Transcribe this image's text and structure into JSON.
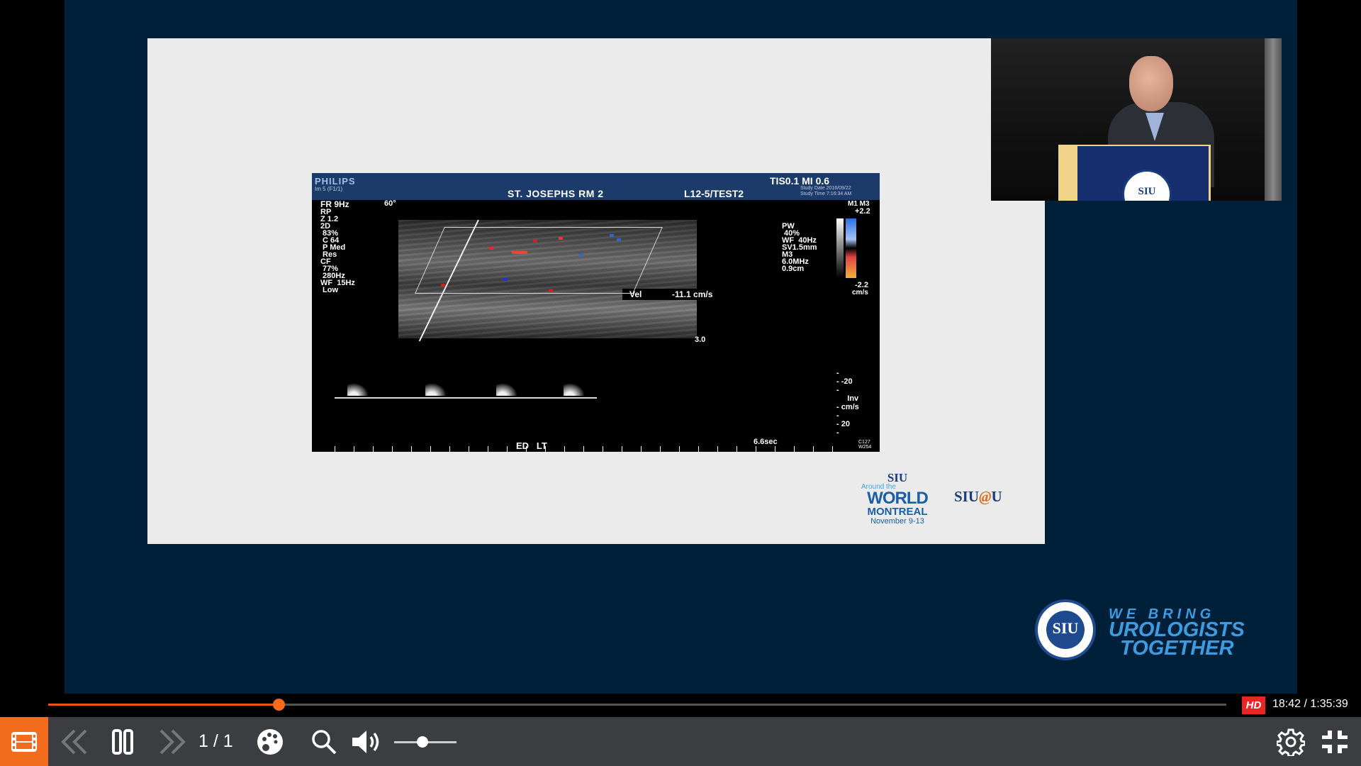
{
  "player": {
    "progress_fraction": 0.1956,
    "hd_label": "HD",
    "time": "18:42 / 1:35:39",
    "pager": "1 / 1",
    "volume_fraction": 0.45,
    "accent_color": "#f26c1d"
  },
  "icons": [
    "film-icon",
    "skip-back-icon",
    "pause-icon",
    "skip-forward-icon",
    "palette-icon",
    "search-icon",
    "volume-icon",
    "gear-icon",
    "exit-fullscreen-icon"
  ],
  "ultrasound": {
    "brand": "PHILIPS",
    "sub": "Im 5 (F1/1)",
    "site": "ST. JOSEPHS RM 2",
    "probe": "L12-5/TEST2",
    "tis": "TIS0.1   MI 0.6",
    "study": "Study Date 2016/09/22\nStudy Time 7:16:34 AM",
    "fr": "FR 9Hz",
    "angle": "60°",
    "params": "RP\nZ 1.2\n2D\n 83%\n C 64\n P Med\n Res\nCF\n 77%\n 280Hz\nWF  15Hz\n Low",
    "vel_label": "Vel",
    "vel_value": "-11.1 cm/s",
    "depth": "3.0",
    "pw": "PW\n 40%\nWF  40Hz\nSV1.5mm\nM3\n6.0MHz\n0.9cm",
    "cbar_top": "M1 M3",
    "cbar_plus": "+2.2",
    "cbar_minus": "-2.2",
    "cbar_unit": "cm/s",
    "scale": "-\n- -20\n-\n     Inv\n- cm/s\n-\n- 20\n-",
    "speed": "6.6sec",
    "bottom": "ED   LT",
    "code": "C127\nW254"
  },
  "logos": {
    "world_siu": "SIU",
    "world_around": "Around the",
    "world_world": "WORLD",
    "world_city": "MONTREAL",
    "world_dates": "November 9-13",
    "siu_at_u_left": "SIU",
    "siu_at_u_at": "@",
    "siu_at_u_right": "U",
    "seal": "SIU",
    "tag1": "WE BRING",
    "tag2": "UROLOGISTS",
    "tag3": "TOGETHER"
  }
}
